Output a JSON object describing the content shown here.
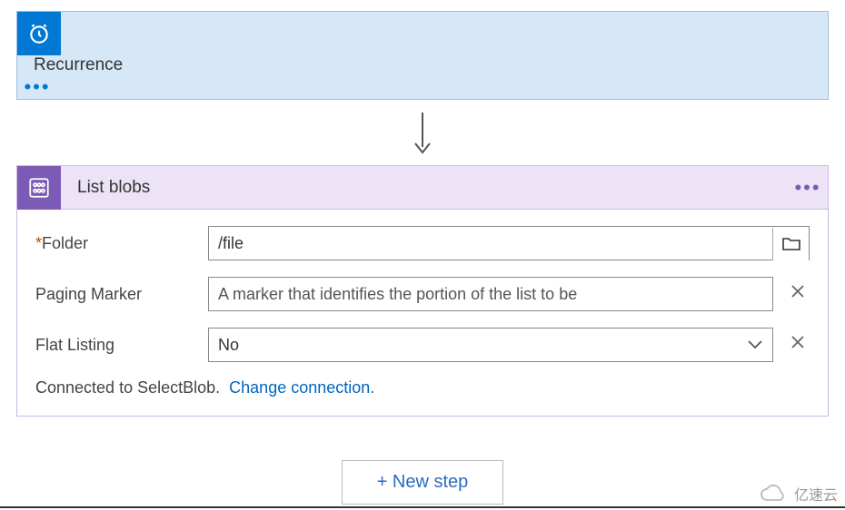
{
  "recurrence": {
    "title": "Recurrence"
  },
  "listblobs": {
    "title": "List blobs",
    "fields": {
      "folder": {
        "label": "Folder",
        "required_mark": "*",
        "value": "/file"
      },
      "paging": {
        "label": "Paging Marker",
        "placeholder": "A marker that identifies the portion of the list to be"
      },
      "flat": {
        "label": "Flat Listing",
        "value": "No"
      }
    },
    "connection": {
      "text": "Connected to SelectBlob.",
      "link": "Change connection."
    }
  },
  "newstep": {
    "label": "+ New step"
  },
  "watermark": {
    "text": "亿速云"
  }
}
